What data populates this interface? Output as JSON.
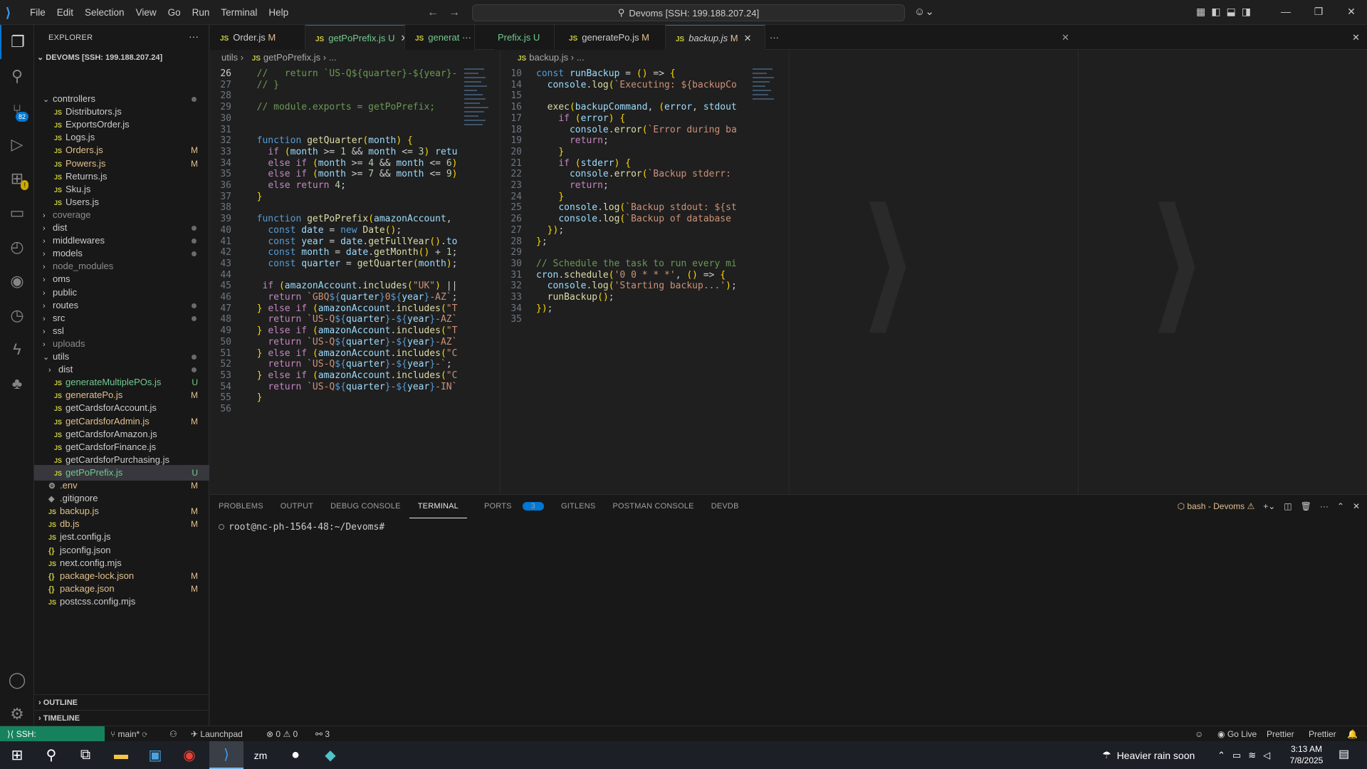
{
  "titlebar": {
    "menu": [
      "File",
      "Edit",
      "Selection",
      "View",
      "Go",
      "Run",
      "Terminal",
      "Help"
    ],
    "command_center": "Devoms [SSH: 199.188.207.24]"
  },
  "activity": {
    "scm_badge": "82"
  },
  "explorer": {
    "title": "EXPLORER",
    "root": "DEVOMS [SSH: 199.188.207.24]",
    "rows": [
      {
        "label": "controllers",
        "kind": "folder-open",
        "color": "norm",
        "status": "dot"
      },
      {
        "label": "Distributors.js",
        "kind": "js",
        "color": "norm",
        "indent": 2
      },
      {
        "label": "ExportsOrder.js",
        "kind": "js",
        "color": "norm",
        "indent": 2
      },
      {
        "label": "Logs.js",
        "kind": "js",
        "color": "norm",
        "indent": 2
      },
      {
        "label": "Orders.js",
        "kind": "js",
        "color": "mod",
        "indent": 2,
        "status": "M"
      },
      {
        "label": "Powers.js",
        "kind": "js",
        "color": "mod",
        "indent": 2,
        "status": "M"
      },
      {
        "label": "Returns.js",
        "kind": "js",
        "color": "norm",
        "indent": 2
      },
      {
        "label": "Sku.js",
        "kind": "js",
        "color": "norm",
        "indent": 2
      },
      {
        "label": "Users.js",
        "kind": "js",
        "color": "norm",
        "indent": 2
      },
      {
        "label": "coverage",
        "kind": "folder",
        "color": "ign"
      },
      {
        "label": "dist",
        "kind": "folder",
        "color": "norm",
        "status": "dot"
      },
      {
        "label": "middlewares",
        "kind": "folder",
        "color": "norm",
        "status": "dot"
      },
      {
        "label": "models",
        "kind": "folder",
        "color": "norm",
        "status": "dot"
      },
      {
        "label": "node_modules",
        "kind": "folder",
        "color": "ign"
      },
      {
        "label": "oms",
        "kind": "folder",
        "color": "norm"
      },
      {
        "label": "public",
        "kind": "folder",
        "color": "norm"
      },
      {
        "label": "routes",
        "kind": "folder",
        "color": "norm",
        "status": "dot"
      },
      {
        "label": "src",
        "kind": "folder",
        "color": "norm",
        "status": "dot"
      },
      {
        "label": "ssl",
        "kind": "folder",
        "color": "norm"
      },
      {
        "label": "uploads",
        "kind": "folder",
        "color": "ign"
      },
      {
        "label": "utils",
        "kind": "folder-open",
        "color": "norm",
        "status": "dot"
      },
      {
        "label": "dist",
        "kind": "folder",
        "color": "norm",
        "indent": 1,
        "status": "dot"
      },
      {
        "label": "generateMultiplePOs.js",
        "kind": "js",
        "color": "unt",
        "indent": 2,
        "status": "U"
      },
      {
        "label": "generatePo.js",
        "kind": "js",
        "color": "mod",
        "indent": 2,
        "status": "M"
      },
      {
        "label": "getCardsforAccount.js",
        "kind": "js",
        "color": "norm",
        "indent": 2
      },
      {
        "label": "getCardsforAdmin.js",
        "kind": "js",
        "color": "mod",
        "indent": 2,
        "status": "M"
      },
      {
        "label": "getCardsforAmazon.js",
        "kind": "js",
        "color": "norm",
        "indent": 2
      },
      {
        "label": "getCardsforFinance.js",
        "kind": "js",
        "color": "norm",
        "indent": 2
      },
      {
        "label": "getCardsforPurchasing.js",
        "kind": "js",
        "color": "norm",
        "indent": 2
      },
      {
        "label": "getPoPrefix.js",
        "kind": "js",
        "color": "unt",
        "indent": 2,
        "status": "U",
        "selected": true
      },
      {
        "label": ".env",
        "kind": "cfg",
        "color": "mod",
        "status": "M"
      },
      {
        "label": ".gitignore",
        "kind": "git",
        "color": "norm"
      },
      {
        "label": "backup.js",
        "kind": "js",
        "color": "mod",
        "status": "M"
      },
      {
        "label": "db.js",
        "kind": "js",
        "color": "mod",
        "status": "M"
      },
      {
        "label": "jest.config.js",
        "kind": "js",
        "color": "norm"
      },
      {
        "label": "jsconfig.json",
        "kind": "json",
        "color": "norm"
      },
      {
        "label": "next.config.mjs",
        "kind": "js",
        "color": "norm"
      },
      {
        "label": "package-lock.json",
        "kind": "json",
        "color": "mod",
        "status": "M"
      },
      {
        "label": "package.json",
        "kind": "json",
        "color": "mod",
        "status": "M"
      },
      {
        "label": "postcss.config.mjs",
        "kind": "js",
        "color": "norm"
      }
    ],
    "outline": "OUTLINE",
    "timeline": "TIMELINE"
  },
  "tabs": [
    {
      "label": "Order.js",
      "status": "M",
      "color": "mod"
    },
    {
      "label": "getPoPrefix.js",
      "status": "U",
      "color": "unt",
      "active": true
    },
    {
      "label": "generat",
      "status": "",
      "color": "unt"
    },
    {
      "label": "Prefix.js",
      "status": "U",
      "color": "unt"
    },
    {
      "label": "generatePo.js",
      "status": "M",
      "color": "mod"
    },
    {
      "label": "backup.js",
      "status": "M",
      "color": "mod",
      "active": true
    }
  ],
  "editor_left": {
    "breadcrumb": [
      "utils",
      "getPoPrefix.js",
      "..."
    ],
    "current_line": 26,
    "lines": [
      {
        "n": 26,
        "t": "  //   return `US-Q${quarter}-${year}-"
      },
      {
        "n": 27,
        "t": "  // }"
      },
      {
        "n": 28,
        "t": ""
      },
      {
        "n": 29,
        "t": "  // module.exports = getPoPrefix;"
      },
      {
        "n": 30,
        "t": ""
      },
      {
        "n": 31,
        "t": ""
      },
      {
        "n": 32,
        "t": "  function getQuarter(month) {"
      },
      {
        "n": 33,
        "t": "    if (month >= 1 && month <= 3) retu"
      },
      {
        "n": 34,
        "t": "    else if (month >= 4 && month <= 6)"
      },
      {
        "n": 35,
        "t": "    else if (month >= 7 && month <= 9)"
      },
      {
        "n": 36,
        "t": "    else return 4;"
      },
      {
        "n": 37,
        "t": "  }"
      },
      {
        "n": 38,
        "t": ""
      },
      {
        "n": 39,
        "t": "  function getPoPrefix(amazonAccount,"
      },
      {
        "n": 40,
        "t": "    const date = new Date();"
      },
      {
        "n": 41,
        "t": "    const year = date.getFullYear().to"
      },
      {
        "n": 42,
        "t": "    const month = date.getMonth() + 1;"
      },
      {
        "n": 43,
        "t": "    const quarter = getQuarter(month);"
      },
      {
        "n": 44,
        "t": ""
      },
      {
        "n": 45,
        "t": "   if (amazonAccount.includes(\"UK\") ||"
      },
      {
        "n": 46,
        "t": "    return `GBQ${quarter}0${year}-AZ`;"
      },
      {
        "n": 47,
        "t": "  } else if (amazonAccount.includes(\"T"
      },
      {
        "n": 48,
        "t": "    return `US-Q${quarter}-${year}-AZ`"
      },
      {
        "n": 49,
        "t": "  } else if (amazonAccount.includes(\"T"
      },
      {
        "n": 50,
        "t": "    return `US-Q${quarter}-${year}-AZ`"
      },
      {
        "n": 51,
        "t": "  } else if (amazonAccount.includes(\"C"
      },
      {
        "n": 52,
        "t": "    return `US-Q${quarter}-${year}-`;"
      },
      {
        "n": 53,
        "t": "  } else if (amazonAccount.includes(\"C"
      },
      {
        "n": 54,
        "t": "    return `US-Q${quarter}-${year}-IN`"
      },
      {
        "n": 55,
        "t": "  }"
      },
      {
        "n": 56,
        "t": ""
      }
    ]
  },
  "editor_right": {
    "breadcrumb": [
      "backup.js",
      "..."
    ],
    "lines": [
      {
        "n": 10,
        "t": "const runBackup = () => {"
      },
      {
        "n": 14,
        "t": "  console.log(`Executing: ${backupCo"
      },
      {
        "n": 15,
        "t": ""
      },
      {
        "n": 16,
        "t": "  exec(backupCommand, (error, stdout"
      },
      {
        "n": 17,
        "t": "    if (error) {"
      },
      {
        "n": 18,
        "t": "      console.error(`Error during ba"
      },
      {
        "n": 19,
        "t": "      return;"
      },
      {
        "n": 20,
        "t": "    }"
      },
      {
        "n": 21,
        "t": "    if (stderr) {"
      },
      {
        "n": 22,
        "t": "      console.error(`Backup stderr:"
      },
      {
        "n": 23,
        "t": "      return;"
      },
      {
        "n": 24,
        "t": "    }"
      },
      {
        "n": 25,
        "t": "    console.log(`Backup stdout: ${st"
      },
      {
        "n": 26,
        "t": "    console.log(`Backup of database"
      },
      {
        "n": 27,
        "t": "  });"
      },
      {
        "n": 28,
        "t": "};"
      },
      {
        "n": 29,
        "t": ""
      },
      {
        "n": 30,
        "t": "// Schedule the task to run every mi"
      },
      {
        "n": 31,
        "t": "cron.schedule('0 0 * * *', () => {"
      },
      {
        "n": 32,
        "t": "  console.log('Starting backup...');"
      },
      {
        "n": 33,
        "t": "  runBackup();"
      },
      {
        "n": 34,
        "t": "});"
      },
      {
        "n": 35,
        "t": ""
      }
    ]
  },
  "panel": {
    "tabs": [
      "PROBLEMS",
      "OUTPUT",
      "DEBUG CONSOLE",
      "TERMINAL",
      "PORTS",
      "GITLENS",
      "POSTMAN CONSOLE",
      "DEVDB"
    ],
    "active_tab": "TERMINAL",
    "ports_badge": "3",
    "shell": "bash - Devoms",
    "prompt": "root@nc-ph-1564-48:~/Devoms#"
  },
  "status": {
    "remote": "SSH: 199.188.207.24",
    "branch": "main*",
    "launchpad": "Launchpad",
    "errors": "0",
    "warnings": "0",
    "ports": "3",
    "golive": "Go Live",
    "prettier1": "Prettier",
    "prettier2": "Prettier"
  },
  "taskbar": {
    "weather": "Heavier rain soon",
    "time": "3:13 AM",
    "date": "7/8/2025"
  }
}
